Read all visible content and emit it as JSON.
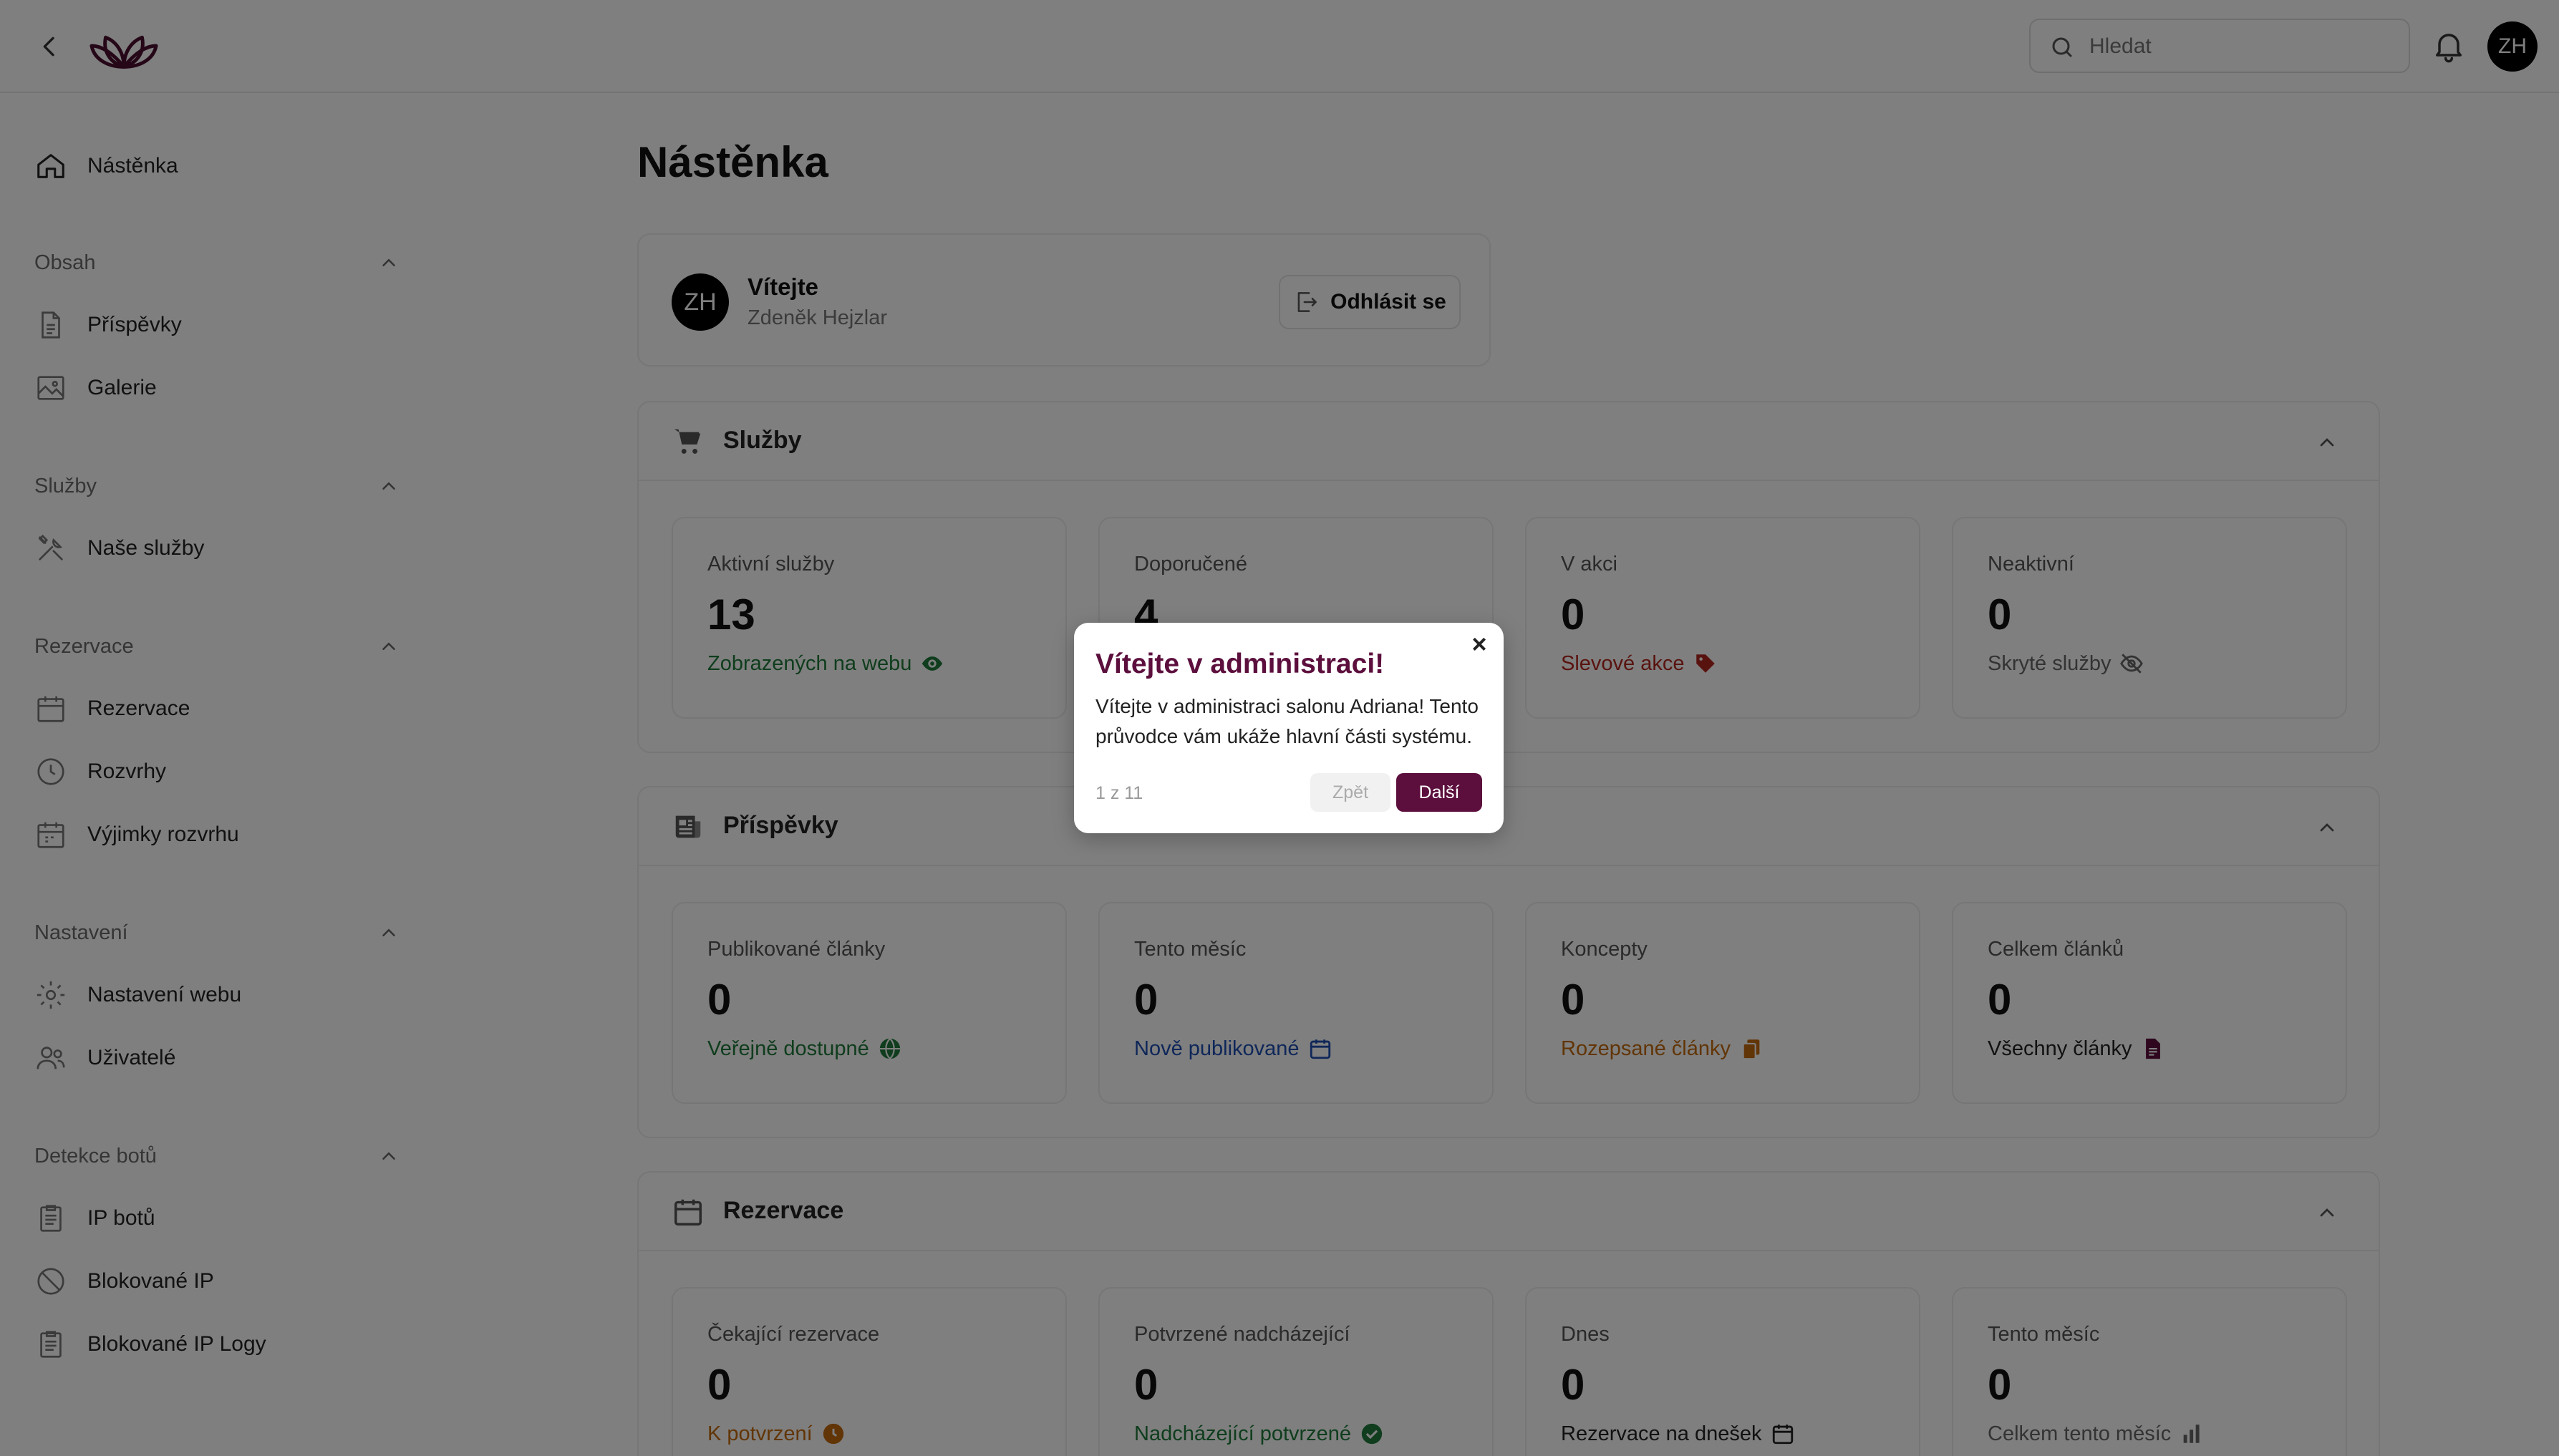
{
  "header": {
    "search_placeholder": "Hledat",
    "avatar_initials": "ZH"
  },
  "sidebar": {
    "dashboard": "Nástěnka",
    "groups": {
      "content": "Obsah",
      "services": "Služby",
      "reservations": "Rezervace",
      "settings": "Nastavení",
      "bots": "Detekce botů"
    },
    "items": {
      "posts": "Příspěvky",
      "gallery": "Galerie",
      "our_services": "Naše služby",
      "reservations": "Rezervace",
      "schedules": "Rozvrhy",
      "schedule_exceptions": "Výjimky rozvrhu",
      "web_settings": "Nastavení webu",
      "users": "Uživatelé",
      "bot_ips": "IP botů",
      "blocked_ips": "Blokované IP",
      "blocked_ip_logs": "Blokované IP Logy"
    }
  },
  "main": {
    "title": "Nástěnka",
    "welcome": {
      "avatar_initials": "ZH",
      "title": "Vítejte",
      "name": "Zdeněk Hejzlar",
      "logout_label": "Odhlásit se"
    },
    "sections": {
      "services": {
        "title": "Služby",
        "stats": [
          {
            "label": "Aktivní služby",
            "value": "13",
            "sub": "Zobrazených na webu",
            "color": "#1f7a3a"
          },
          {
            "label": "Doporučené",
            "value": "4",
            "sub": "",
            "color": "#1f7a3a"
          },
          {
            "label": "V akci",
            "value": "0",
            "sub": "Slevové akce",
            "color": "#b3261e"
          },
          {
            "label": "Neaktivní",
            "value": "0",
            "sub": "Skryté služby",
            "color": "#666666"
          }
        ]
      },
      "posts": {
        "title": "Příspěvky",
        "stats": [
          {
            "label": "Publikované články",
            "value": "0",
            "sub": "Veřejně dostupné",
            "color": "#1f7a3a"
          },
          {
            "label": "Tento měsíc",
            "value": "0",
            "sub": "Nově publikované",
            "color": "#1e4fb3"
          },
          {
            "label": "Koncepty",
            "value": "0",
            "sub": "Rozepsané články",
            "color": "#c46a0c"
          },
          {
            "label": "Celkem článků",
            "value": "0",
            "sub": "Všechny články",
            "color": "#222222"
          }
        ]
      },
      "reservations": {
        "title": "Rezervace",
        "stats": [
          {
            "label": "Čekající rezervace",
            "value": "0",
            "sub": "K potvrzení",
            "color": "#c46a0c"
          },
          {
            "label": "Potvrzené nadcházející",
            "value": "0",
            "sub": "Nadcházející potvrzené",
            "color": "#1f7a3a"
          },
          {
            "label": "Dnes",
            "value": "0",
            "sub": "Rezervace na dnešek",
            "color": "#222222"
          },
          {
            "label": "Tento měsíc",
            "value": "0",
            "sub": "Celkem tento měsíc",
            "color": "#666666"
          }
        ]
      }
    }
  },
  "tour_modal": {
    "close": "×",
    "title": "Vítejte v administraci!",
    "text": "Vítejte v administraci salonu Adriana! Tento průvodce vám ukáže hlavní části systému.",
    "step": "1 z 11",
    "prev_label": "Zpět",
    "next_label": "Další"
  },
  "colors": {
    "brand": "#5c0f3d",
    "green": "#1f7a3a",
    "red": "#b3261e",
    "blue": "#1e4fb3",
    "orange": "#c46a0c"
  }
}
